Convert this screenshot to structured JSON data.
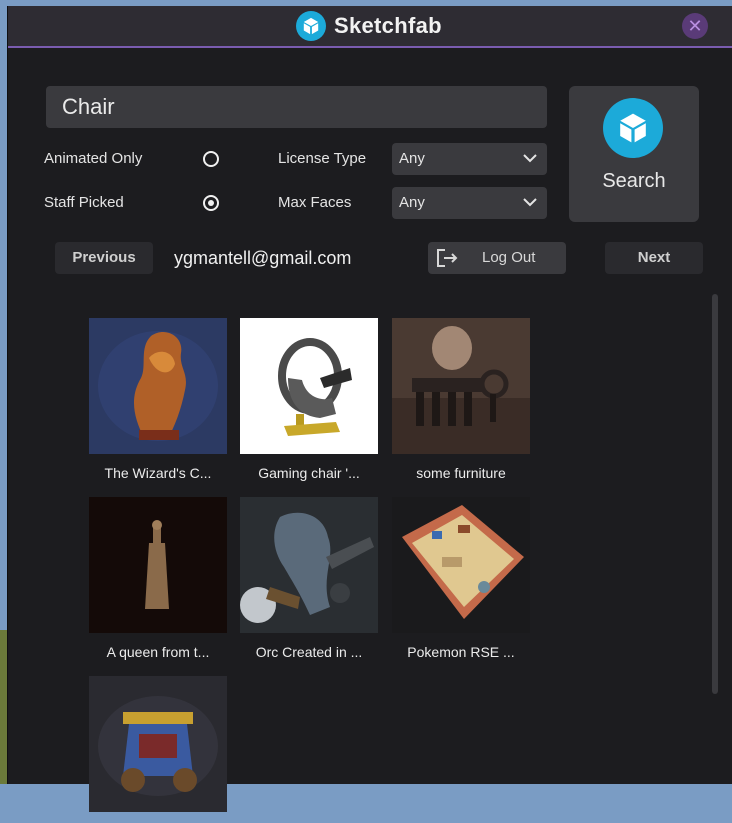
{
  "app": {
    "title": "Sketchfab",
    "close_glyph": "✕"
  },
  "search": {
    "query": "Chair",
    "button_label": "Search"
  },
  "filters": {
    "animated_only": {
      "label": "Animated Only",
      "checked": false
    },
    "staff_picked": {
      "label": "Staff Picked",
      "checked": true
    },
    "license_type": {
      "label": "License Type",
      "value": "Any"
    },
    "max_faces": {
      "label": "Max Faces",
      "value": "Any"
    }
  },
  "nav": {
    "previous": "Previous",
    "next": "Next",
    "user_email": "ygmantell@gmail.com",
    "logout": "Log Out"
  },
  "results": [
    {
      "caption": "The Wizard's C...",
      "thumb": "wizard"
    },
    {
      "caption": "Gaming chair '...",
      "thumb": "gaming"
    },
    {
      "caption": "some furniture",
      "thumb": "furniture"
    },
    {
      "caption": "A queen from t...",
      "thumb": "queen"
    },
    {
      "caption": "Orc Created in ...",
      "thumb": "orc"
    },
    {
      "caption": "Pokemon RSE ...",
      "thumb": "pokemon"
    },
    {
      "caption": "",
      "thumb": "carriage"
    }
  ],
  "colors": {
    "accent": "#1caad9",
    "title_border": "#7a5cb0",
    "bg": "#1c1c1f",
    "panel": "#3a3a3e"
  }
}
